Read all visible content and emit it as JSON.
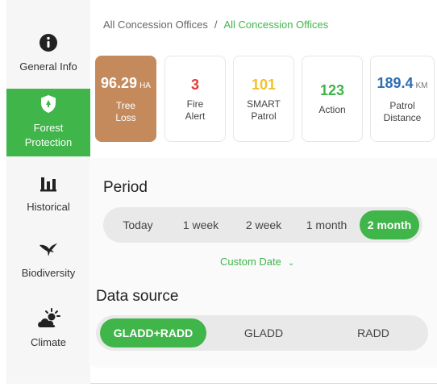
{
  "breadcrumb": {
    "parent": "All Concession Offices",
    "separator": "/",
    "current": "All Concession Offices"
  },
  "sidebar": {
    "items": [
      {
        "label": "General Info",
        "icon": "info-icon",
        "active": false
      },
      {
        "label": "Forest Protection",
        "icon": "shield-icon",
        "active": true
      },
      {
        "label": "Historical",
        "icon": "bar-chart-icon",
        "active": false
      },
      {
        "label": "Biodiversity",
        "icon": "bird-icon",
        "active": false
      },
      {
        "label": "Climate",
        "icon": "sun-cloud-icon",
        "active": false
      }
    ]
  },
  "stats": [
    {
      "value": "96.29",
      "unit": "HA",
      "label": "Tree Loss",
      "color": "#ffffff",
      "highlight": true
    },
    {
      "value": "3",
      "unit": "",
      "label": "Fire Alert",
      "color": "#e53935",
      "highlight": false
    },
    {
      "value": "101",
      "unit": "",
      "label": "SMART Patrol",
      "color": "#f2c12e",
      "highlight": false
    },
    {
      "value": "123",
      "unit": "",
      "label": "Action",
      "color": "#3fb54a",
      "highlight": false
    },
    {
      "value": "189.4",
      "unit": "KM",
      "label": "Patrol Distance",
      "color": "#2e6fb7",
      "highlight": false
    }
  ],
  "period": {
    "title": "Period",
    "options": [
      "Today",
      "1 week",
      "2 week",
      "1 month",
      "2 month"
    ],
    "selected": "2 month",
    "custom_date_label": "Custom Date"
  },
  "data_source": {
    "title": "Data source",
    "options": [
      "GLADD+RADD",
      "GLADD",
      "RADD"
    ],
    "selected": "GLADD+RADD"
  },
  "colors": {
    "accent": "#3fb54a",
    "tree_loss": "#c58a5c"
  }
}
